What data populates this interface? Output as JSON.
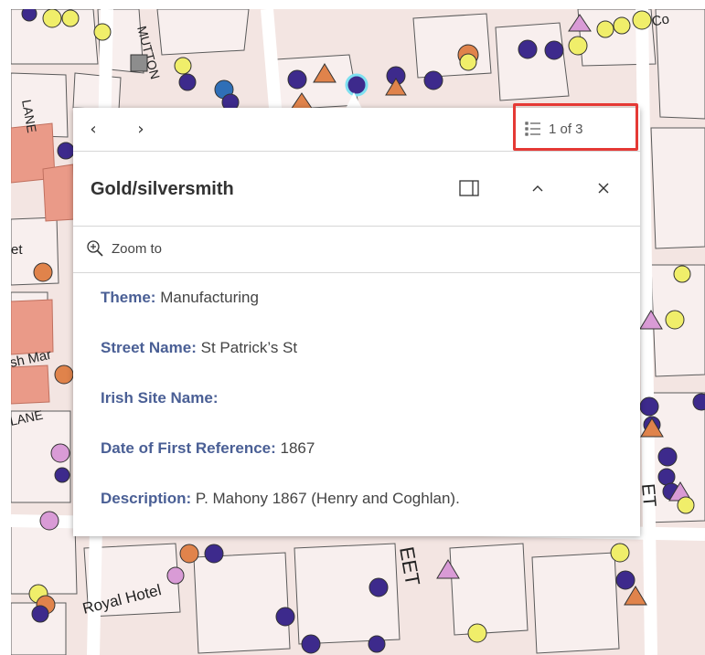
{
  "map": {
    "labels": {
      "mutton": "MUTTON",
      "lane_top": "LANE",
      "street_left": "et",
      "fish_market": "sh Mar",
      "lane_mid": "LANE",
      "royal_hotel": "Royal Hotel",
      "street_bottom": "EET",
      "street_right": "ET",
      "top_right": "Of Co"
    },
    "colors": {
      "background": "#f3e5e2",
      "building": "#f8efee",
      "highlight_building": "#ea9a88",
      "road": "#ffffff",
      "point_purple": "#3d2a8c",
      "point_yellow": "#f0ee6a",
      "point_orange": "#e0834b",
      "point_gray": "#8d8d8d",
      "point_pink": "#d99bd6",
      "point_blue": "#2f6fb7"
    }
  },
  "popup": {
    "nav": {
      "prev_icon": "chevron-left-icon",
      "next_icon": "chevron-right-icon",
      "list_icon": "list-icon",
      "feature_count": "1 of 3"
    },
    "title": "Gold/silversmith",
    "dock_icon": "dock-icon",
    "collapse_icon": "chevron-up-icon",
    "close_icon": "close-icon",
    "zoom_icon": "zoom-in-icon",
    "zoom_label": "Zoom to",
    "attributes": [
      {
        "key": "Theme:",
        "value": "Manufacturing"
      },
      {
        "key": "Street Name:",
        "value": "St Patrick’s St"
      },
      {
        "key": "Irish Site Name:",
        "value": ""
      },
      {
        "key": "Date of First Reference:",
        "value": "1867"
      },
      {
        "key": "Description:",
        "value": "P. Mahony 1867 (Henry and Coghlan)."
      }
    ],
    "highlight_color": "#e53935"
  }
}
